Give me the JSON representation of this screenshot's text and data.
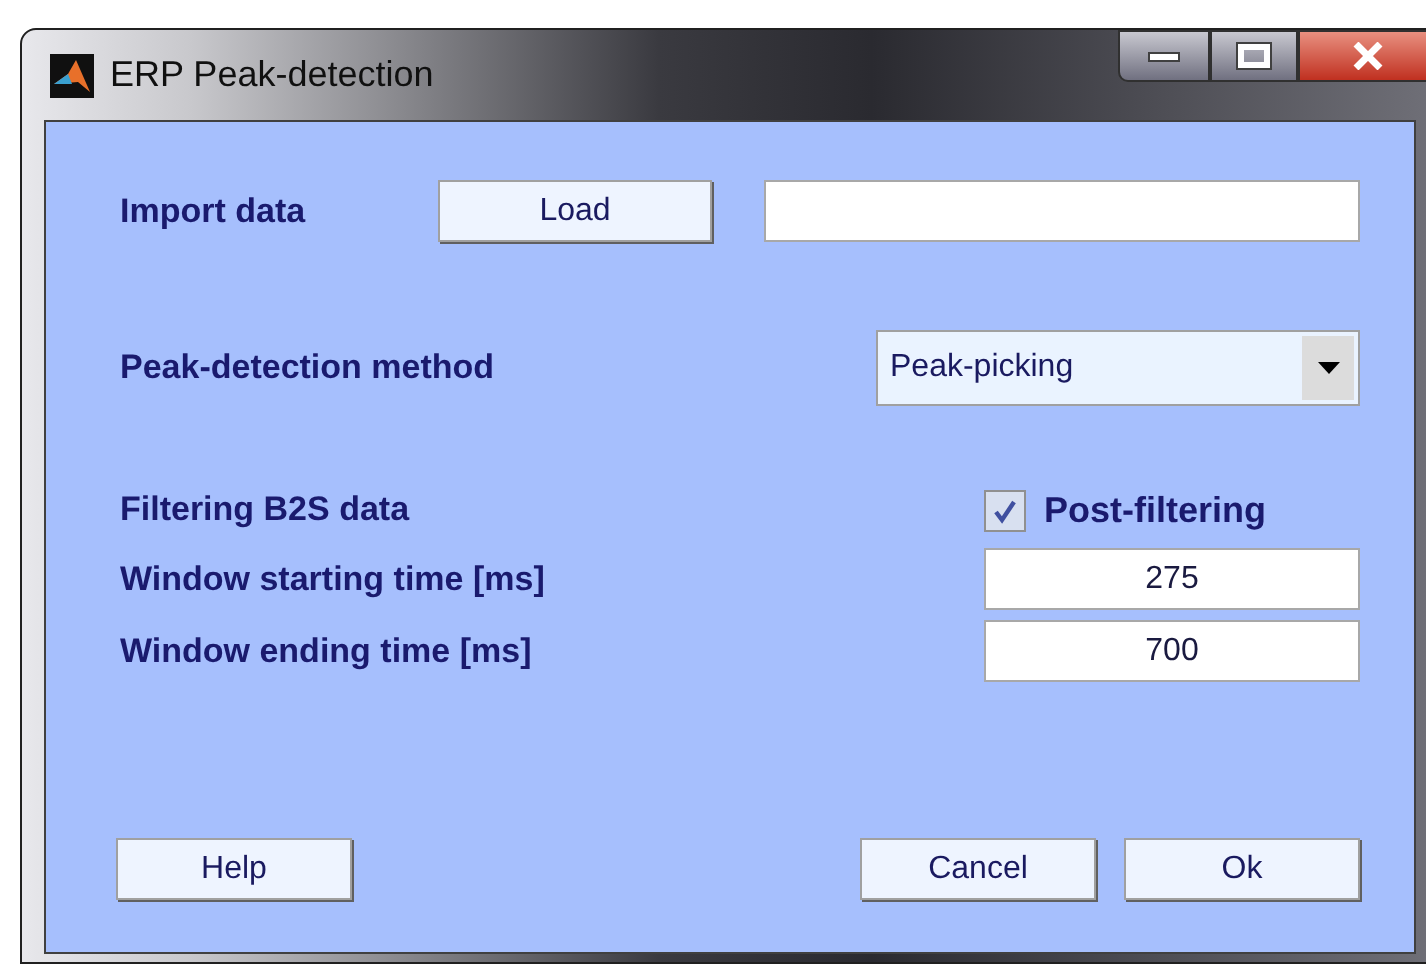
{
  "window": {
    "title": "ERP Peak-detection"
  },
  "import_data": {
    "label": "Import data",
    "button": "Load"
  },
  "method": {
    "label": "Peak-detection method",
    "value": "Peak-picking"
  },
  "filtering": {
    "label": "Filtering B2S data",
    "checkbox": {
      "label": "Post-filtering",
      "checked": true
    }
  },
  "fields": [
    {
      "label": "Window starting time [ms]",
      "value": "275"
    },
    {
      "label": "Window ending time [ms]",
      "value": "700"
    }
  ],
  "buttons": [
    "Help",
    "Cancel",
    "Ok"
  ]
}
